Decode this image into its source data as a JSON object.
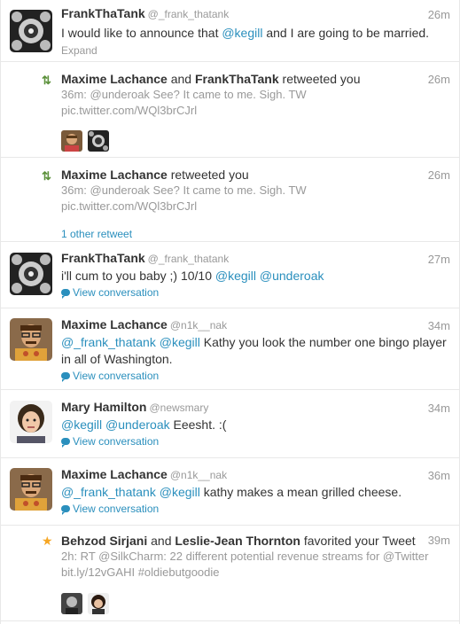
{
  "items": [
    {
      "kind": "tweet",
      "name": "FrankThaTank",
      "handle": "@_frank_thatank",
      "time": "26m",
      "text_parts": [
        "I would like to announce that ",
        "@kegill",
        " and I are going to be married."
      ],
      "footer": "Expand"
    },
    {
      "kind": "retweet",
      "actors": [
        "Maxime Lachance",
        "FrankThaTank"
      ],
      "joiner": "and",
      "action": "retweeted you",
      "time": "26m",
      "line1": "36m: @underoak See? It came to me. Sigh. TW",
      "line2": "pic.twitter.com/WQl3brCJrl"
    },
    {
      "kind": "retweet",
      "actors": [
        "Maxime Lachance"
      ],
      "action": "retweeted you",
      "time": "26m",
      "line1": "36m: @underoak See? It came to me. Sigh. TW",
      "line2": "pic.twitter.com/WQl3brCJrl",
      "footer": "1 other retweet"
    },
    {
      "kind": "tweet",
      "name": "FrankThaTank",
      "handle": "@_frank_thatank",
      "time": "27m",
      "text_parts": [
        "i'll cum to you baby ;) 10/10 ",
        "@kegill",
        " ",
        "@underoak"
      ],
      "footer": "View conversation"
    },
    {
      "kind": "tweet",
      "name": "Maxime Lachance",
      "handle": "@n1k__nak",
      "time": "34m",
      "text_parts": [
        "@_frank_thatank",
        " ",
        "@kegill",
        " Kathy you look the number one bingo player in all of Washington."
      ],
      "footer": "View conversation"
    },
    {
      "kind": "tweet",
      "name": "Mary Hamilton",
      "handle": "@newsmary",
      "time": "34m",
      "text_parts": [
        "@kegill",
        " ",
        "@underoak",
        " Eeesht. :("
      ],
      "footer": "View conversation"
    },
    {
      "kind": "tweet",
      "name": "Maxime Lachance",
      "handle": "@n1k__nak",
      "time": "36m",
      "text_parts": [
        "@_frank_thatank",
        " ",
        "@kegill",
        " kathy makes a mean grilled cheese."
      ],
      "footer": "View conversation"
    },
    {
      "kind": "favorite",
      "actors": [
        "Behzod Sirjani",
        "Leslie-Jean Thornton"
      ],
      "joiner": "and",
      "action": "favorited your Tweet",
      "time": "39m",
      "line1": "2h: RT @SilkCharm: 22 different potential revenue streams for @Twitter",
      "line2": "bit.ly/12vGAHI #oldiebutgoodie"
    }
  ],
  "colors": {
    "link": "#2a8fbd",
    "retweet": "#5c913b",
    "favorite": "#f6a623",
    "muted": "#999999"
  }
}
